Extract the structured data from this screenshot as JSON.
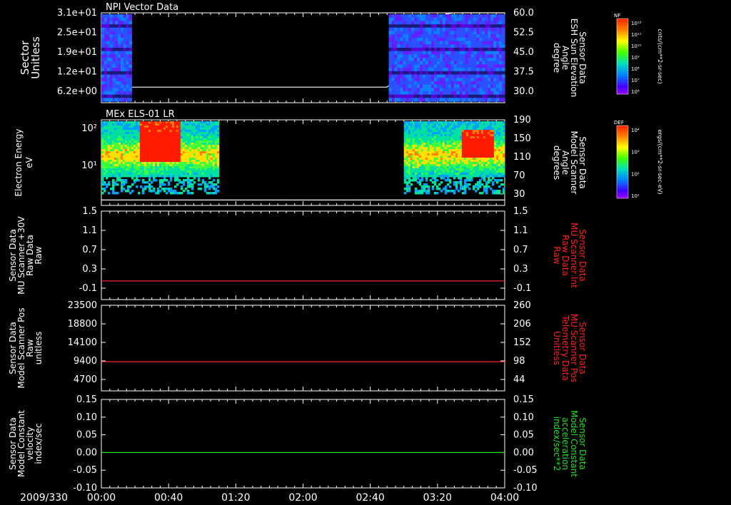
{
  "date_label": "2009/330",
  "time_ticks": [
    "00:00",
    "00:40",
    "01:20",
    "02:00",
    "02:40",
    "03:20",
    "04:00"
  ],
  "chart_data": [
    {
      "id": "npi",
      "type": "heatmap",
      "title": "NPI Vector Data",
      "ylabel_left": [
        "Sector",
        "Unitless"
      ],
      "ylabel_right": [
        "Sensor Data",
        "ESH Sun Elevation",
        "Angle",
        "degree"
      ],
      "left_ticks": [
        "3.1e+01",
        "2.5e+01",
        "1.9e+01",
        "1.2e+01",
        "6.2e+00"
      ],
      "right_ticks": [
        "60.0",
        "52.5",
        "45.0",
        "37.5",
        "30.0"
      ],
      "ylim_right": [
        22.5,
        60.0
      ],
      "data_blocks_minutes": [
        [
          0,
          18
        ],
        [
          171,
          240
        ]
      ],
      "line_series": {
        "name": "ESH Sun Elevation",
        "color": "#ffffff",
        "x_minutes": [
          0,
          6,
          10,
          14,
          17,
          30,
          170,
          180,
          190,
          200,
          205,
          210,
          240
        ],
        "y": [
          57,
          44,
          33,
          29.5,
          29,
          29,
          29,
          35,
          45,
          55,
          59.5,
          60,
          60
        ]
      },
      "colorbar": {
        "label": "NF",
        "units": "cnts/(cm**2-sr-sec)",
        "ticks": [
          "10¹²",
          "10¹¹",
          "10¹⁰",
          "10⁹",
          "10⁸",
          "10⁷",
          "10⁶"
        ]
      }
    },
    {
      "id": "els",
      "type": "heatmap",
      "title": "MEx ELS-01 LR",
      "ylabel_left": [
        "Electron Energy",
        "eV"
      ],
      "ylabel_right": [
        "Sensor Data",
        "Model Scanner",
        "Angle",
        "degrees"
      ],
      "left_ticks": [
        "10²",
        "10¹"
      ],
      "right_ticks": [
        "190",
        "150",
        "110",
        "70",
        "30"
      ],
      "ylim_right": [
        0,
        190
      ],
      "data_blocks_minutes": [
        [
          0,
          70
        ],
        [
          180,
          240
        ]
      ],
      "line_series": {
        "name": "Model Scanner Angle",
        "color": "#ffffff",
        "x_minutes": [
          0,
          240
        ],
        "y": [
          12,
          12
        ]
      },
      "colorbar": {
        "label": "DEF",
        "units": "ergs/(cm**2-sr-sec-eV)",
        "ticks": [
          "10⁴",
          "10³",
          "10²",
          "10¹"
        ]
      }
    },
    {
      "id": "mu_int",
      "type": "line",
      "ylabel_left": [
        "Sensor Data",
        "MU Scanner +30V",
        "Raw Data",
        "Raw"
      ],
      "ylabel_right": [
        "Sensor Data",
        "MU Scanner Int",
        "Raw Data",
        "Raw"
      ],
      "ylabel_right_color": "#ff2020",
      "left_ticks": [
        "1.5",
        "1.1",
        "0.7",
        "0.3",
        "-0.1"
      ],
      "right_ticks": [
        "1.5",
        "1.1",
        "0.7",
        "0.3",
        "-0.1"
      ],
      "ylim": [
        -0.4,
        1.5
      ],
      "series": [
        {
          "name": "MU Scanner Int",
          "color": "#ff2020",
          "x_minutes": [
            0,
            240
          ],
          "y": [
            0,
            0
          ]
        }
      ]
    },
    {
      "id": "mu_pos",
      "type": "line",
      "ylabel_left": [
        "Sensor Data",
        "Model Scanner Pos",
        "Raw",
        "unitless"
      ],
      "ylabel_right": [
        "Sensor Data",
        "MU Scanner Pos",
        "Telemetry Data",
        "Unitless"
      ],
      "ylabel_right_color": "#ff2020",
      "left_ticks": [
        "23500",
        "18800",
        "14100",
        "9400",
        "4700"
      ],
      "right_ticks": [
        "260",
        "206",
        "152",
        "98",
        "44"
      ],
      "ylim": [
        0,
        23500
      ],
      "series": [
        {
          "name": "MU Scanner Pos",
          "color": "#ff2020",
          "x_minutes": [
            0,
            240
          ],
          "y": [
            8000,
            8000
          ]
        }
      ]
    },
    {
      "id": "constant",
      "type": "line",
      "ylabel_left": [
        "Sensor Data",
        "Model Constant",
        "velocity",
        "index/sec"
      ],
      "ylabel_right": [
        "Sensor Data",
        "Model Constant",
        "acceleration",
        "index/sec**2"
      ],
      "ylabel_right_color": "#20e020",
      "left_ticks": [
        "0.15",
        "0.10",
        "0.05",
        "0.00",
        "-0.05",
        "-0.10"
      ],
      "right_ticks": [
        "0.15",
        "0.10",
        "0.05",
        "0.00",
        "-0.05",
        "-0.10"
      ],
      "ylim": [
        -0.1,
        0.15
      ],
      "series": [
        {
          "name": "Model Constant acceleration",
          "color": "#20e020",
          "x_minutes": [
            0,
            240
          ],
          "y": [
            0,
            0
          ]
        }
      ]
    }
  ]
}
